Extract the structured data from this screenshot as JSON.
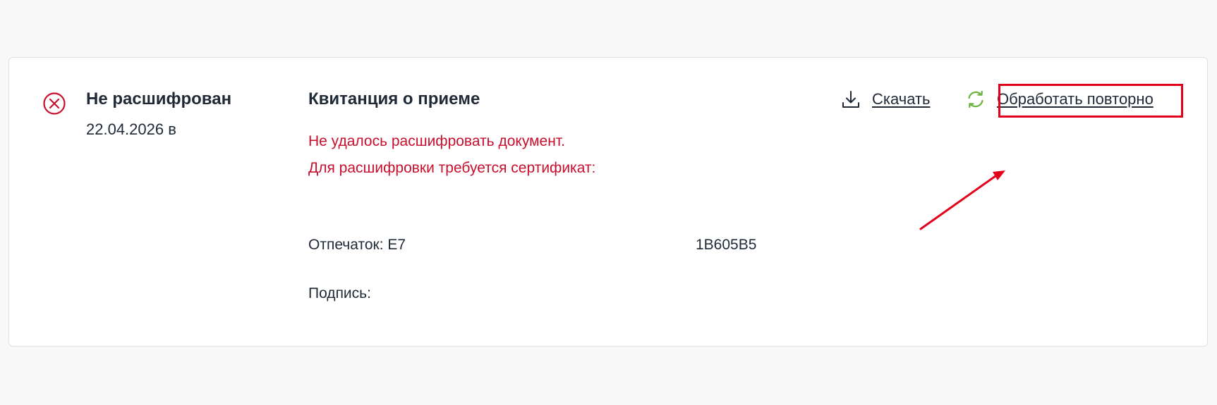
{
  "status": {
    "icon": "error-circle-x-icon",
    "title": "Не расшифрован",
    "date": "22.04.2026 в",
    "color": "#c8102e"
  },
  "document": {
    "title": "Квитанция о приеме",
    "error_line_1": "Не удалось расшифровать документ.",
    "error_line_2": "Для расшифровки требуется сертификат:",
    "thumbprint_label": "Отпечаток: E7",
    "thumbprint_tail": "1B605B5",
    "signature_label": "Подпись:"
  },
  "actions": {
    "download": {
      "label": "Скачать",
      "icon": "download-icon"
    },
    "retry": {
      "label": "Обработать повторно",
      "icon": "refresh-icon",
      "icon_color": "#6cb33f"
    }
  },
  "annotation": {
    "highlight_color": "#e3001b"
  }
}
